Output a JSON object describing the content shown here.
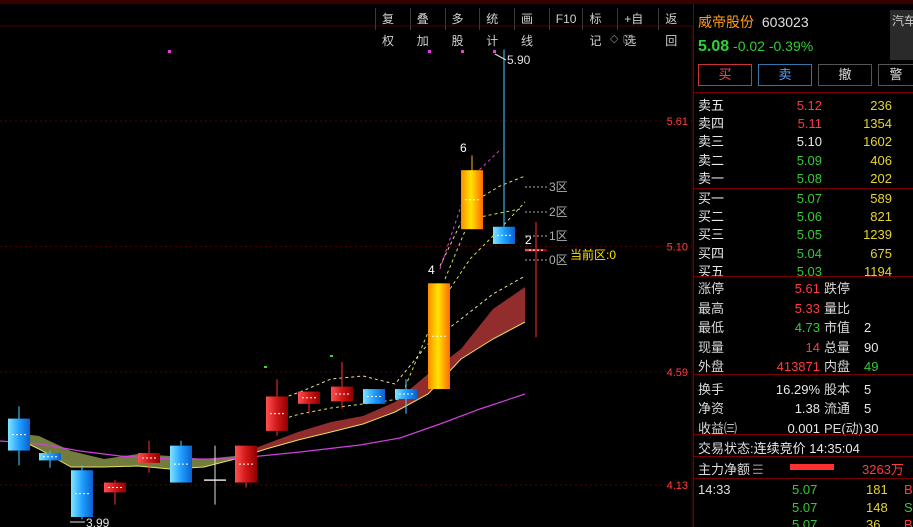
{
  "toolbar": [
    "复权",
    "叠加",
    "多股",
    "统计",
    "画线",
    "F10",
    "标记",
    "+自选",
    "返回"
  ],
  "chart": {
    "price_labels": [
      "5.61",
      "5.10",
      "4.59",
      "4.13"
    ],
    "high_label": "5.90",
    "low_label": "3.99",
    "zone_labels": [
      "3区",
      "2区",
      "1区",
      "0区"
    ],
    "current_zone": "当前区:0",
    "wave_labels": [
      "6",
      "4",
      "2"
    ],
    "icons": [
      "diamond-icon",
      "window-icon"
    ]
  },
  "chart_data": {
    "type": "candlestick",
    "y_axis_ticks": [
      5.61,
      5.1,
      4.59,
      4.13
    ],
    "candles": [
      {
        "open": 4.4,
        "high": 4.45,
        "low": 4.21,
        "close": 4.27,
        "color": "cyan"
      },
      {
        "open": 4.26,
        "high": 4.27,
        "low": 4.2,
        "close": 4.23,
        "color": "cyan"
      },
      {
        "open": 4.19,
        "high": 4.21,
        "low": 3.99,
        "close": 4.0,
        "color": "cyan"
      },
      {
        "open": 4.1,
        "high": 4.15,
        "low": 4.05,
        "close": 4.14,
        "color": "red"
      },
      {
        "open": 4.22,
        "high": 4.31,
        "low": 4.18,
        "close": 4.26,
        "color": "red"
      },
      {
        "open": 4.29,
        "high": 4.31,
        "low": 4.14,
        "close": 4.14,
        "color": "cyan"
      },
      {
        "open": 4.15,
        "high": 4.29,
        "low": 4.05,
        "close": 4.15,
        "color": "white"
      },
      {
        "open": 4.14,
        "high": 4.28,
        "low": 4.12,
        "close": 4.29,
        "color": "red"
      },
      {
        "open": 4.35,
        "high": 4.56,
        "low": 4.33,
        "close": 4.49,
        "color": "red"
      },
      {
        "open": 4.46,
        "high": 4.51,
        "low": 4.42,
        "close": 4.51,
        "color": "red"
      },
      {
        "open": 4.47,
        "high": 4.63,
        "low": 4.44,
        "close": 4.53,
        "color": "red"
      },
      {
        "open": 4.52,
        "high": 4.52,
        "low": 4.46,
        "close": 4.46,
        "color": "cyan"
      },
      {
        "open": 4.52,
        "high": 4.56,
        "low": 4.42,
        "close": 4.48,
        "color": "cyan"
      },
      {
        "open": 4.52,
        "high": 4.95,
        "low": 4.52,
        "close": 4.95,
        "color": "gold"
      },
      {
        "open": 5.41,
        "high": 5.47,
        "low": 5.17,
        "close": 5.17,
        "color": "gold"
      },
      {
        "open": 5.18,
        "high": 5.9,
        "low": 5.11,
        "close": 5.11,
        "color": "cyan"
      },
      {
        "open": 5.09,
        "high": 5.2,
        "low": 4.73,
        "close": 5.08,
        "color": "red"
      }
    ]
  },
  "stock": {
    "name": "威帝股份",
    "code": "603023",
    "price": "5.08",
    "change": "-0.02",
    "change_pct": "-0.39%",
    "side_text": "汽车"
  },
  "buttons": {
    "buy": "买",
    "sell": "卖",
    "cancel": "撤",
    "more": "警"
  },
  "orderbook": {
    "asks": [
      {
        "label": "卖五",
        "price": "5.12",
        "vol": "236",
        "pcolor": "red"
      },
      {
        "label": "卖四",
        "price": "5.11",
        "vol": "1354",
        "pcolor": "red"
      },
      {
        "label": "卖三",
        "price": "5.10",
        "vol": "1602",
        "pcolor": "white"
      },
      {
        "label": "卖二",
        "price": "5.09",
        "vol": "406",
        "pcolor": "green"
      },
      {
        "label": "卖一",
        "price": "5.08",
        "vol": "202",
        "pcolor": "green"
      }
    ],
    "bids": [
      {
        "label": "买一",
        "price": "5.07",
        "vol": "589",
        "pcolor": "green"
      },
      {
        "label": "买二",
        "price": "5.06",
        "vol": "821",
        "pcolor": "green"
      },
      {
        "label": "买三",
        "price": "5.05",
        "vol": "1239",
        "pcolor": "green"
      },
      {
        "label": "买四",
        "price": "5.04",
        "vol": "675",
        "pcolor": "green"
      },
      {
        "label": "买五",
        "price": "5.03",
        "vol": "1194",
        "pcolor": "green"
      }
    ]
  },
  "stats": [
    {
      "l1": "涨停",
      "v1": "5.61",
      "c1": "red",
      "l2": "跌停",
      "v2": "",
      "c2": "green"
    },
    {
      "l1": "最高",
      "v1": "5.33",
      "c1": "red",
      "l2": "量比",
      "v2": "",
      "c2": "white"
    },
    {
      "l1": "最低",
      "v1": "4.73",
      "c1": "green",
      "l2": "市值",
      "v2": "2",
      "c2": "white"
    },
    {
      "l1": "现量",
      "v1": "14",
      "c1": "red",
      "l2": "总量",
      "v2": "90",
      "c2": "white"
    },
    {
      "l1": "外盘",
      "v1": "413871",
      "c1": "red",
      "l2": "内盘",
      "v2": "49",
      "c2": "green"
    },
    {
      "l1": "换手",
      "v1": "16.29%",
      "c1": "white",
      "l2": "股本",
      "v2": "5",
      "c2": "white"
    },
    {
      "l1": "净资",
      "v1": "1.38",
      "c1": "white",
      "l2": "流通",
      "v2": "5",
      "c2": "white"
    },
    {
      "l1": "收益㈢",
      "v1": "0.001",
      "c1": "white",
      "l2": "PE(动)",
      "v2": "30",
      "c2": "white"
    }
  ],
  "status": {
    "label": "交易状态:",
    "value": "连续竞价",
    "time": "14:35:04"
  },
  "flow": {
    "label": "主力净额",
    "value": "3263万"
  },
  "ticks": [
    {
      "time": "14:33",
      "price": "5.07",
      "vol": "181",
      "dir": "B",
      "dcolor": "red"
    },
    {
      "time": "",
      "price": "5.07",
      "vol": "148",
      "dir": "S",
      "dcolor": "green"
    },
    {
      "time": "",
      "price": "5.07",
      "vol": "36",
      "dir": "B",
      "dcolor": "red"
    }
  ]
}
